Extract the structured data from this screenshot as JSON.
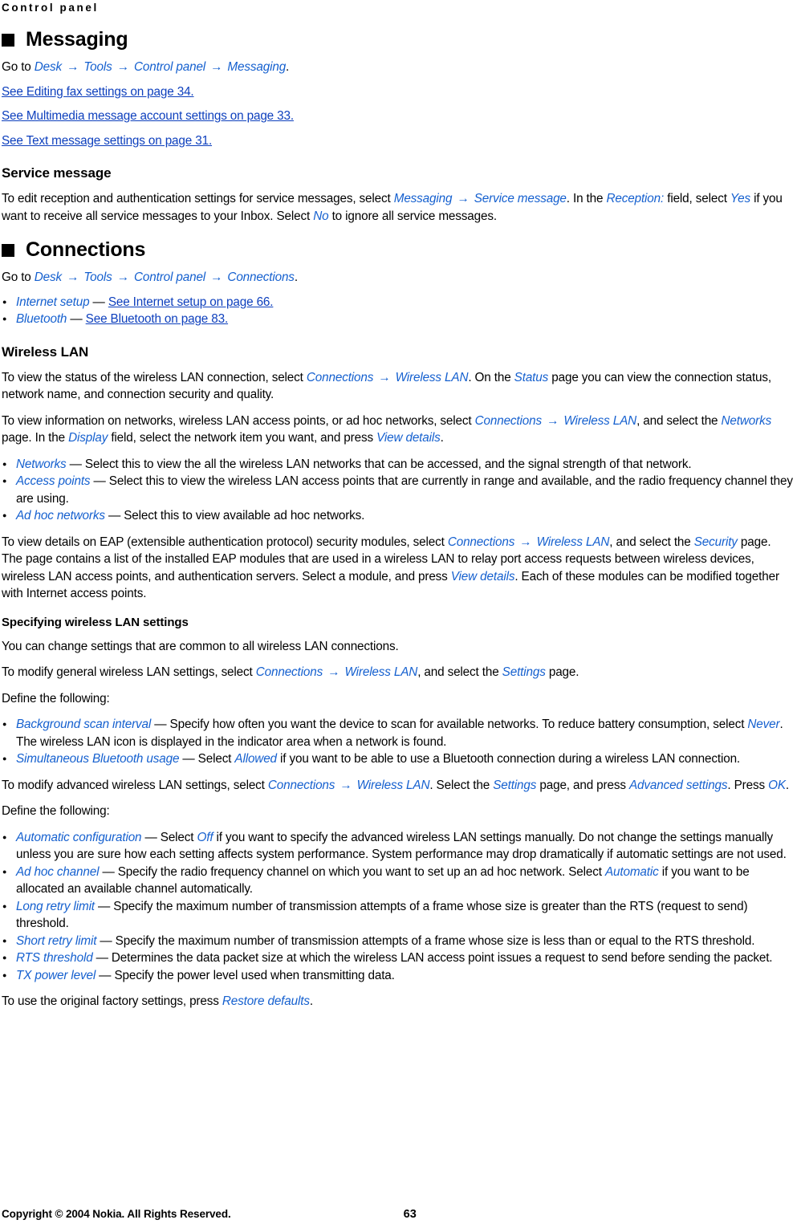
{
  "running_head": "Control panel",
  "colors": {
    "link": "#0d3fbd",
    "ui_italic": "#1560cf",
    "text": "#000000",
    "background": "#ffffff"
  },
  "sections": [
    {
      "id": "messaging",
      "title": "Messaging",
      "goto_prefix": "Go to ",
      "goto_path": [
        "Desk",
        "Tools",
        "Control panel",
        "Messaging"
      ],
      "goto_suffix": ".",
      "links": [
        "See Editing fax settings on page 34.",
        "See Multimedia message account settings on page 33.",
        "See Text message settings on page 31."
      ],
      "subsection": {
        "heading": "Service message",
        "para_1a": "To edit reception and authentication settings for service messages, select ",
        "ui_messaging": "Messaging",
        "arrow": "→",
        "ui_service_message": "Service message",
        "para_1b": ". In the ",
        "ui_reception": "Reception:",
        "para_1c": " field, select ",
        "ui_yes": "Yes",
        "para_1d": " if you want to receive all service messages to your Inbox. Select ",
        "ui_no": "No",
        "para_1e": " to ignore all service messages."
      }
    },
    {
      "id": "connections",
      "title": "Connections",
      "goto_prefix": "Go to ",
      "goto_path": [
        "Desk",
        "Tools",
        "Control panel",
        "Connections"
      ],
      "goto_suffix": ".",
      "bullets": [
        {
          "term": "Internet setup",
          "dash": " — ",
          "link": "See Internet setup on page 66."
        },
        {
          "term": "Bluetooth",
          "dash": " — ",
          "link": "See Bluetooth on page 83."
        }
      ]
    }
  ],
  "wireless_lan": {
    "heading": "Wireless LAN",
    "p1": {
      "a": "To view the status of the wireless LAN connection, select ",
      "ui1": "Connections",
      "arrow": "→",
      "ui2": "Wireless LAN",
      "b": ". On the ",
      "ui3": "Status",
      "c": " page you can view the connection status, network name, and connection security and quality."
    },
    "p2": {
      "a": "To view information on networks, wireless LAN access points, or ad hoc networks, select ",
      "ui1": "Connections",
      "arrow": "→",
      "ui2": "Wireless LAN",
      "b": ", and select the ",
      "ui3": "Networks",
      "c": " page. In the ",
      "ui4": "Display",
      "d": " field, select the network item you want, and press ",
      "ui5": "View details",
      "e": "."
    },
    "bullets": [
      {
        "term": "Networks",
        "dash": " — ",
        "text": "Select this to view the all the wireless LAN networks that can be accessed, and the signal strength of that network."
      },
      {
        "term": "Access points",
        "dash": " — ",
        "text": "Select this to view the wireless LAN access points that are currently in range and available, and the radio frequency channel they are using."
      },
      {
        "term": "Ad hoc networks",
        "dash": " — ",
        "text": "Select this to view available ad hoc networks."
      }
    ],
    "p3": {
      "a": "To view details on EAP (extensible authentication protocol) security modules, select ",
      "ui1": "Connections",
      "arrow": "→",
      "ui2": "Wireless LAN",
      "b": ", and select the ",
      "ui3": "Security",
      "c": " page. The page contains a list of the installed EAP modules that are used in a wireless LAN to relay port access requests between wireless devices, wireless LAN access points, and authentication servers. Select a module, and press ",
      "ui4": "View details",
      "d": ". Each of these modules can be modified together with Internet access points."
    },
    "specifying": {
      "heading": "Specifying wireless LAN settings",
      "p1": "You can change settings that are common to all wireless LAN connections.",
      "p2": {
        "a": "To modify general wireless LAN settings, select ",
        "ui1": "Connections",
        "arrow": "→",
        "ui2": "Wireless LAN",
        "b": ", and select the ",
        "ui3": "Settings",
        "c": " page."
      },
      "define": "Define the following:",
      "bullets": [
        {
          "term": "Background scan interval",
          "dash": " — ",
          "text_a": "Specify how often you want the device to scan for available networks. To reduce battery consumption, select ",
          "ui": "Never",
          "text_b": ". The wireless LAN icon is displayed in the indicator area when a network is found."
        },
        {
          "term": "Simultaneous Bluetooth usage",
          "dash": " — ",
          "text_a": "Select ",
          "ui": "Allowed",
          "text_b": " if you want to be able to use a Bluetooth connection during a wireless LAN connection."
        }
      ]
    },
    "advanced": {
      "p1": {
        "a": "To modify advanced wireless LAN settings, select ",
        "ui1": "Connections",
        "arrow": "→",
        "ui2": "Wireless LAN",
        "b": ". Select the ",
        "ui3": "Settings",
        "c": " page, and press ",
        "ui4": "Advanced settings",
        "d": ". Press ",
        "ui5": "OK",
        "e": "."
      },
      "define": "Define the following:",
      "bullets": [
        {
          "term": "Automatic configuration",
          "dash": " — ",
          "text_a": "Select ",
          "ui": "Off",
          "text_b": " if you want to specify the advanced wireless LAN settings manually. Do not change the settings manually unless you are sure how each setting affects system performance. System performance may drop dramatically if automatic settings are not used."
        },
        {
          "term": "Ad hoc channel",
          "dash": " — ",
          "text_a": "Specify the radio frequency channel on which you want to set up an ad hoc network. Select ",
          "ui": "Automatic",
          "text_b": " if you want to be allocated an available channel automatically."
        },
        {
          "term": "Long retry limit",
          "dash": " — ",
          "text_a": "Specify the maximum number of transmission attempts of a frame whose size is greater than the RTS (request to send) threshold.",
          "ui": "",
          "text_b": ""
        },
        {
          "term": "Short retry limit",
          "dash": " — ",
          "text_a": "Specify the maximum number of transmission attempts of a frame whose size is less than or equal to the RTS threshold.",
          "ui": "",
          "text_b": ""
        },
        {
          "term": "RTS threshold",
          "dash": " — ",
          "text_a": "Determines the data packet size at which the wireless LAN access point issues a request to send before sending the packet.",
          "ui": "",
          "text_b": ""
        },
        {
          "term": "TX power level",
          "dash": " — ",
          "text_a": "Specify the power level used when transmitting data.",
          "ui": "",
          "text_b": ""
        }
      ],
      "restore": {
        "a": "To use the original factory settings, press ",
        "ui": "Restore defaults",
        "b": "."
      }
    }
  },
  "footer": {
    "copyright": "Copyright © 2004 Nokia. All Rights Reserved.",
    "page_number": "63"
  }
}
